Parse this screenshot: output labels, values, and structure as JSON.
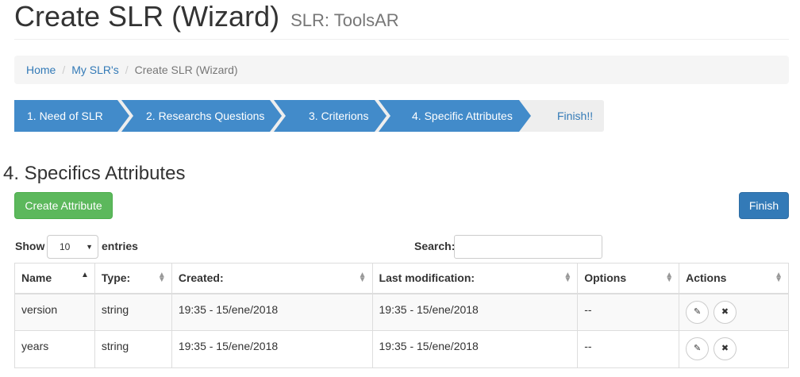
{
  "header": {
    "title": "Create SLR (Wizard)",
    "subtitle": "SLR: ToolsAR"
  },
  "breadcrumb": {
    "items": [
      "Home",
      "My SLR's"
    ],
    "active": "Create SLR (Wizard)"
  },
  "wizard": {
    "steps": [
      "1. Need of SLR",
      "2. Researchs Questions",
      "3. Criterions",
      "4. Specific Attributes"
    ],
    "finish": "Finish!!",
    "active_color": "#428bca",
    "inactive_color": "#eeeeee"
  },
  "section": {
    "title": "4. Specifics Attributes"
  },
  "buttons": {
    "create": "Create Attribute",
    "finish": "Finish"
  },
  "controls": {
    "show": "Show",
    "length_value": "10",
    "entries": "entries",
    "search_label": "Search:"
  },
  "table": {
    "headers": [
      "Name",
      "Type:",
      "Created:",
      "Last modification:",
      "Options",
      "Actions"
    ],
    "rows": [
      {
        "name": "version",
        "type": "string",
        "created": "19:35 - 15/ene/2018",
        "modified": "19:35 - 15/ene/2018",
        "options": "--"
      },
      {
        "name": "years",
        "type": "string",
        "created": "19:35 - 15/ene/2018",
        "modified": "19:35 - 15/ene/2018",
        "options": "--"
      }
    ]
  }
}
